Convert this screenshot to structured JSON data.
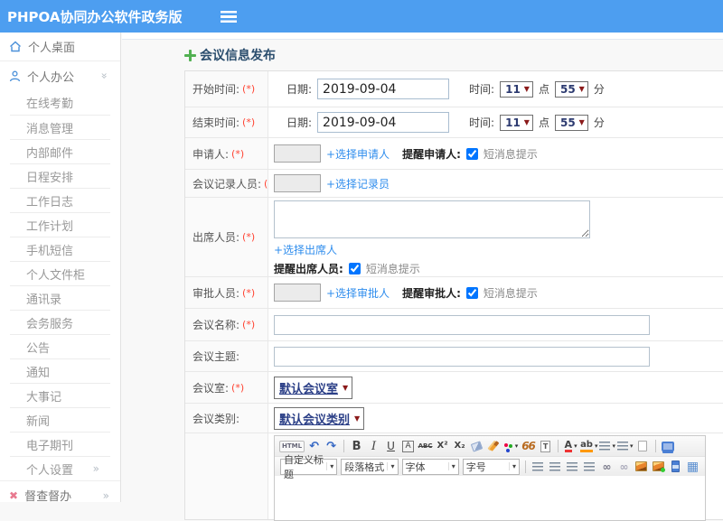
{
  "colors": {
    "topbar": "#4d9ef0",
    "link": "#2f8ded",
    "sidebar_icon": "#4a90d9",
    "title": "#2a4d6d",
    "required": "#ff4433",
    "select_text": "#2b3f87"
  },
  "app": {
    "title": "PHPOA协同办公软件政务版"
  },
  "sidebar": {
    "desktop_label": "个人桌面",
    "office_label": "个人办公",
    "sub_items": [
      {
        "label": "在线考勤"
      },
      {
        "label": "消息管理"
      },
      {
        "label": "内部邮件"
      },
      {
        "label": "日程安排"
      },
      {
        "label": "工作日志"
      },
      {
        "label": "工作计划"
      },
      {
        "label": "手机短信"
      },
      {
        "label": "个人文件柜"
      },
      {
        "label": "通讯录"
      },
      {
        "label": "会务服务"
      },
      {
        "label": "公告"
      },
      {
        "label": "通知"
      },
      {
        "label": "大事记"
      },
      {
        "label": "新闻"
      },
      {
        "label": "电子期刊"
      },
      {
        "label": "个人设置",
        "chevron": "»"
      }
    ],
    "supervision_label": "督查督办",
    "supervision_chevron": "»"
  },
  "page": {
    "title": "会议信息发布"
  },
  "form": {
    "rows": {
      "start_time": {
        "label": "开始时间:",
        "required": "(*)",
        "date_label": "日期:",
        "date_value": "2019-09-04",
        "time_label": "时间:",
        "hour": "11",
        "hour_unit": "点",
        "minute": "55",
        "minute_unit": "分"
      },
      "end_time": {
        "label": "结束时间:",
        "required": "(*)",
        "date_label": "日期:",
        "date_value": "2019-09-04",
        "time_label": "时间:",
        "hour": "11",
        "hour_unit": "点",
        "minute": "55",
        "minute_unit": "分"
      },
      "applicant": {
        "label": "申请人:",
        "required": "(*)",
        "choose_link": "+选择申请人",
        "remind_label": "提醒申请人:",
        "sms_label": "短消息提示",
        "sms_checked": true
      },
      "recorder": {
        "label": "会议记录人员:",
        "required": "(*)",
        "choose_link": "+选择记录员"
      },
      "attendees": {
        "label": "出席人员:",
        "required": "(*)",
        "choose_link": "+选择出席人",
        "remind_label": "提醒出席人员:",
        "sms_label": "短消息提示",
        "sms_checked": true
      },
      "approver": {
        "label": "审批人员:",
        "required": "(*)",
        "choose_link": "+选择审批人",
        "remind_label": "提醒审批人:",
        "sms_label": "短消息提示",
        "sms_checked": true
      },
      "meeting_name": {
        "label": "会议名称:",
        "required": "(*)",
        "value": ""
      },
      "meeting_subject": {
        "label": "会议主题:",
        "value": ""
      },
      "meeting_room": {
        "label": "会议室:",
        "required": "(*)",
        "value": "默认会议室"
      },
      "meeting_type": {
        "label": "会议类别:",
        "value": "默认会议类别"
      }
    }
  },
  "editor": {
    "toolbar_row1": [
      {
        "kind": "btn",
        "name": "html-source",
        "glyph": "HTML"
      },
      {
        "kind": "btn",
        "name": "undo",
        "glyph": "↶"
      },
      {
        "kind": "btn",
        "name": "redo",
        "glyph": "↷"
      },
      {
        "kind": "sep"
      },
      {
        "kind": "btn",
        "name": "bold",
        "glyph": "B"
      },
      {
        "kind": "btn",
        "name": "italic",
        "glyph": "I"
      },
      {
        "kind": "btn",
        "name": "underline",
        "glyph": "U"
      },
      {
        "kind": "btn",
        "name": "text-style",
        "glyph": "A"
      },
      {
        "kind": "btn",
        "name": "strikethrough",
        "glyph": "ABC"
      },
      {
        "kind": "btn",
        "name": "superscript",
        "glyph": "X²"
      },
      {
        "kind": "btn",
        "name": "subscript",
        "glyph": "X₂"
      },
      {
        "kind": "btn",
        "name": "remove-format"
      },
      {
        "kind": "btn",
        "name": "format-brush"
      },
      {
        "kind": "btn",
        "name": "color-palette",
        "dd": true
      },
      {
        "kind": "btn",
        "name": "blockquote",
        "glyph": "66"
      },
      {
        "kind": "btn",
        "name": "paste-text",
        "glyph": "T"
      },
      {
        "kind": "sep"
      },
      {
        "kind": "btn",
        "name": "font-color",
        "glyph": "A",
        "dd": true
      },
      {
        "kind": "btn",
        "name": "highlight-color",
        "glyph": "ab",
        "dd": true
      },
      {
        "kind": "btn",
        "name": "ordered-list",
        "dd": true
      },
      {
        "kind": "btn",
        "name": "unordered-list",
        "dd": true
      },
      {
        "kind": "btn",
        "name": "new-page"
      },
      {
        "kind": "sep"
      },
      {
        "kind": "btn",
        "name": "fullscreen"
      }
    ],
    "toolbar_row2": [
      {
        "kind": "select",
        "name": "heading-select",
        "label": "自定义标题"
      },
      {
        "kind": "select",
        "name": "paragraph-select",
        "label": "段落格式"
      },
      {
        "kind": "select",
        "name": "font-family-select",
        "label": "字体"
      },
      {
        "kind": "select",
        "name": "font-size-select",
        "label": "字号"
      },
      {
        "kind": "sep"
      },
      {
        "kind": "btn",
        "name": "align-left"
      },
      {
        "kind": "btn",
        "name": "align-center"
      },
      {
        "kind": "btn",
        "name": "align-right"
      },
      {
        "kind": "btn",
        "name": "align-justify"
      },
      {
        "kind": "btn",
        "name": "link",
        "glyph": "∞"
      },
      {
        "kind": "btn",
        "name": "unlink",
        "glyph": "∞"
      },
      {
        "kind": "btn",
        "name": "image"
      },
      {
        "kind": "btn",
        "name": "image-upload"
      },
      {
        "kind": "btn",
        "name": "media"
      },
      {
        "kind": "btn",
        "name": "table",
        "glyph": "▦"
      }
    ]
  }
}
